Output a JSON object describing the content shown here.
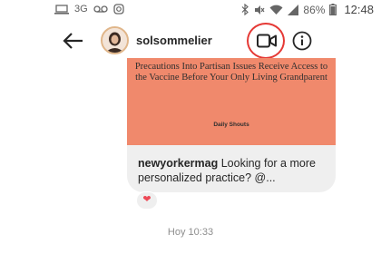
{
  "status_bar": {
    "network": "3G",
    "battery": "86%",
    "time": "12:48"
  },
  "header": {
    "username": "solsommelier"
  },
  "shared_post": {
    "headline": "Precautions Into Partisan Issues Receive Access to the Vaccine Before Your Only Living Grandparent",
    "section": "Daily Shouts",
    "author": "newyorkermag",
    "caption": "Looking for a more personalized practice? @..."
  },
  "reaction": "❤",
  "timestamp": "Hoy 10:33",
  "colors": {
    "post_image_background": "#f0896c",
    "highlight_ring": "#e53935",
    "heart": "#ed4956"
  },
  "icons": [
    "laptop-icon",
    "voicemail-icon",
    "instagram-icon",
    "bluetooth-icon",
    "mute-icon",
    "wifi-icon",
    "signal-icon",
    "battery-icon",
    "back-arrow-icon",
    "video-call-icon",
    "info-icon",
    "heart-icon"
  ]
}
